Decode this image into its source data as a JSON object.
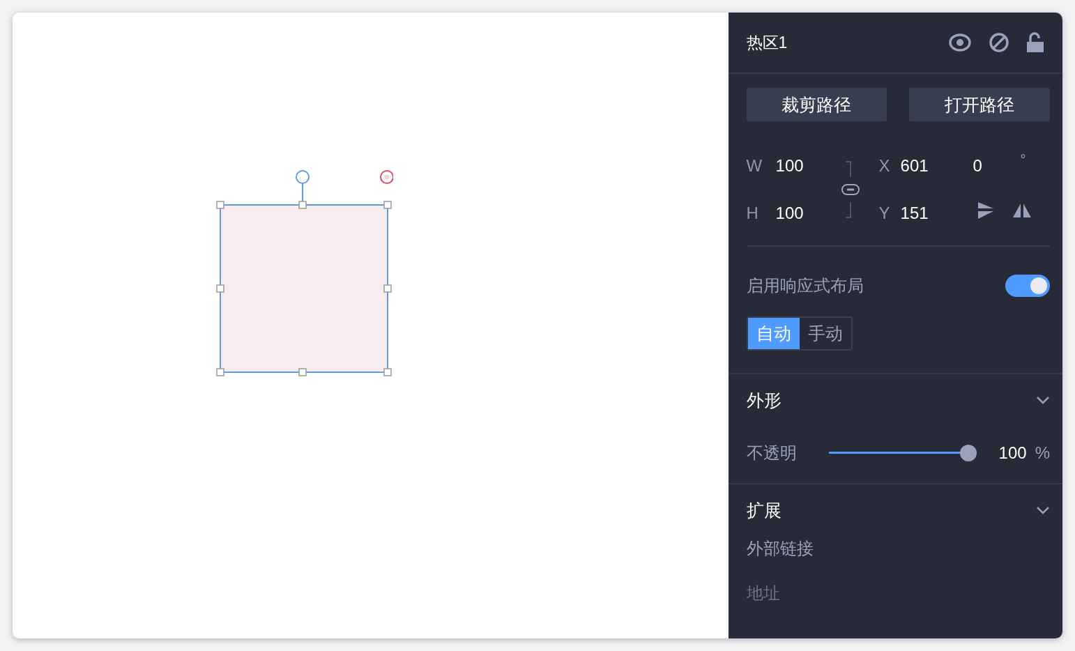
{
  "panel": {
    "title": "热区1",
    "buttons": [
      "裁剪路径",
      "打开路径"
    ],
    "size": [
      {
        "label": "W",
        "value": "100"
      },
      {
        "label": "H",
        "value": "100"
      }
    ],
    "position": [
      {
        "label": "X",
        "value": "601"
      },
      {
        "label": "Y",
        "value": "151"
      }
    ],
    "rotation": {
      "value": "0",
      "unit": "°"
    },
    "responsive": {
      "label": "启用响应式布局",
      "on": true,
      "modes": [
        {
          "label": "自动",
          "selected": true
        },
        {
          "label": "手动",
          "selected": false
        }
      ]
    },
    "appearance": {
      "title": "外形",
      "expanded": true,
      "opacity": {
        "label": "不透明",
        "level": 1,
        "value": "100",
        "unit": "%"
      }
    },
    "extension": {
      "title": "扩展",
      "expanded": true,
      "link_label": "外部链接",
      "address_placeholder": "地址"
    }
  }
}
